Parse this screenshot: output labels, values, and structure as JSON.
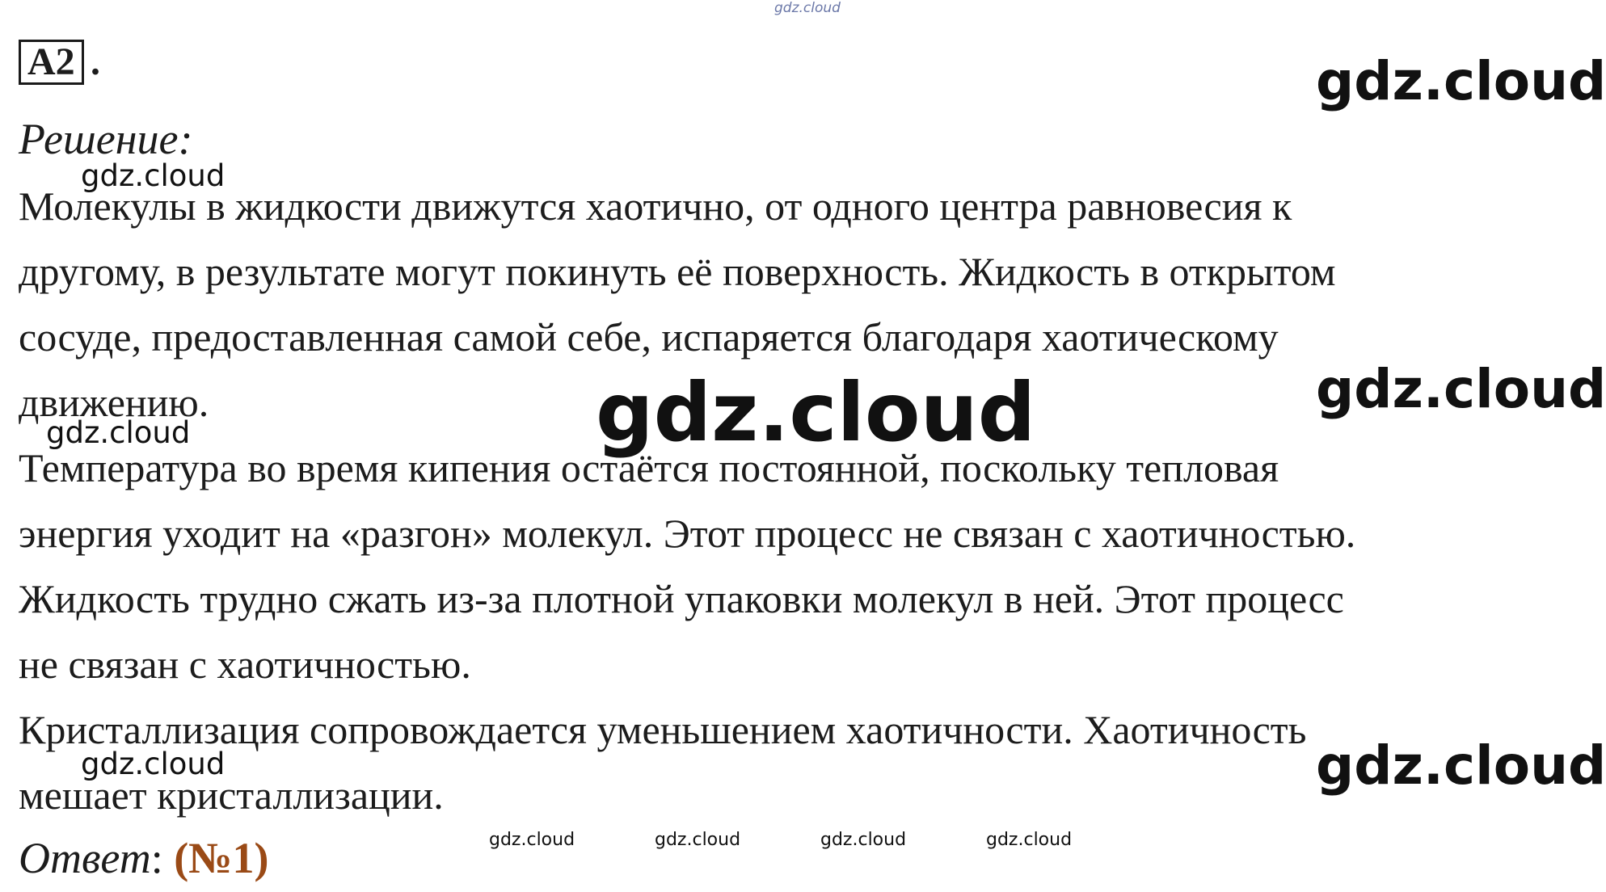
{
  "task": {
    "number": "А2",
    "dot": "."
  },
  "solution_label": "Решение:",
  "paragraphs": [
    {
      "lines": [
        "Молекулы в жидкости движутся хаотично, от одного центра равновесия к",
        "другому, в результате могут покинуть её поверхность. Жидкость в открытом",
        "сосуде, предоставленная самой себе, испаряется благодаря хаотическому",
        "движению."
      ]
    },
    {
      "lines": [
        "Температура во время кипения остаётся постоянной, поскольку тепловая",
        "энергия уходит на «разгон» молекул. Этот процесс не связан с хаотичностью."
      ]
    },
    {
      "lines": [
        "Жидкость трудно сжать из-за плотной упаковки молекул в ней. Этот процесс",
        "не связан с хаотичностью."
      ]
    },
    {
      "lines": [
        "Кристаллизация сопровождается уменьшением хаотичности. Хаотичность",
        "мешает кристаллизации."
      ]
    }
  ],
  "answer": {
    "label": "Ответ",
    "colon": ":",
    "value": "(№1)"
  },
  "watermarks": {
    "top": "gdz.cloud",
    "large": [
      "gdz.cloud",
      "gdz.cloud",
      "gdz.cloud"
    ],
    "center": "gdz.cloud",
    "small": [
      "gdz.cloud",
      "gdz.cloud",
      "gdz.cloud"
    ],
    "tiny": [
      "gdz.cloud",
      "gdz.cloud",
      "gdz.cloud",
      "gdz.cloud"
    ]
  },
  "colors": {
    "text": "#1c1c1c",
    "answer": "#9a4a16",
    "top_watermark": "#6b78a8"
  }
}
